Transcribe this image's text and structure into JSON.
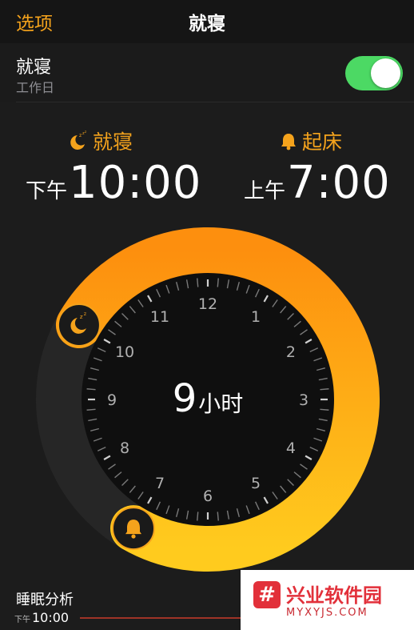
{
  "nav": {
    "left_label": "选项",
    "title": "就寝"
  },
  "bedtime_row": {
    "title": "就寝",
    "subtitle": "工作日",
    "toggle_on": true
  },
  "bedtime": {
    "label": "就寝",
    "prefix": "下午",
    "time": "10:00",
    "icon": "moon-zzz-icon"
  },
  "wake": {
    "label": "起床",
    "prefix": "上午",
    "time": "7:00",
    "icon": "bell-icon"
  },
  "clock": {
    "hours": [
      "12",
      "1",
      "2",
      "3",
      "4",
      "5",
      "6",
      "7",
      "8",
      "9",
      "10",
      "11"
    ],
    "duration_value": "9",
    "duration_unit": "小时",
    "arc_start_hour": 10,
    "arc_end_hour": 7
  },
  "analysis": {
    "title": "睡眠分析",
    "prefix": "下午",
    "time": "10:00"
  },
  "watermark": {
    "badge": "#",
    "title": "兴业软件园",
    "url": "MYXYJS.COM"
  },
  "colors": {
    "accent": "#f5a31c",
    "toggle": "#4cd964",
    "arc_start": "#fd8f0e",
    "arc_end": "#ffcb1e"
  }
}
